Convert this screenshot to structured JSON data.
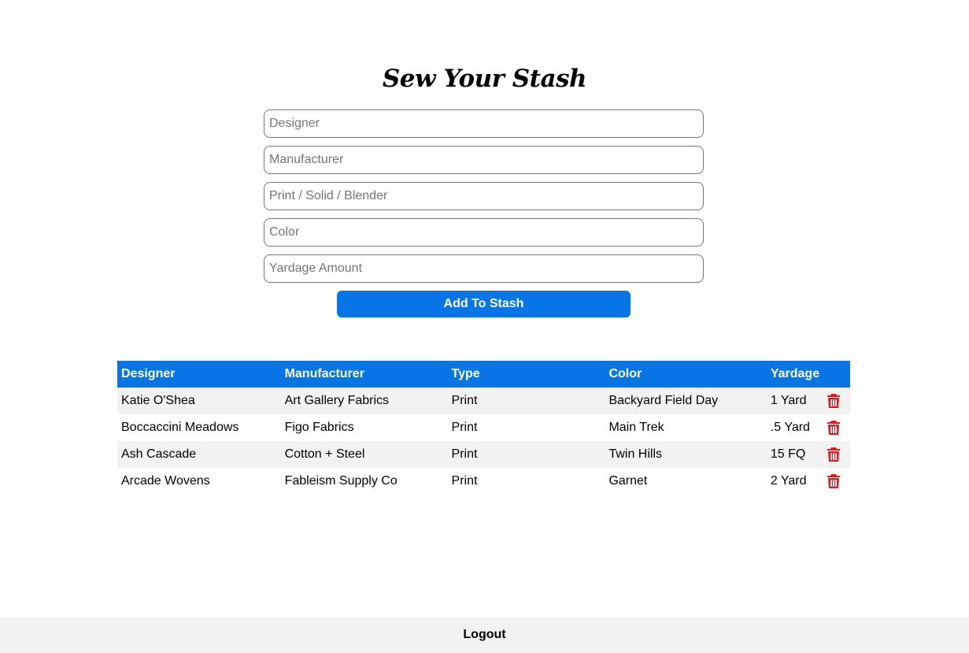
{
  "header": {
    "title": "Sew Your Stash"
  },
  "form": {
    "designer_placeholder": "Designer",
    "manufacturer_placeholder": "Manufacturer",
    "type_placeholder": "Print / Solid / Blender",
    "color_placeholder": "Color",
    "yardage_placeholder": "Yardage Amount",
    "submit_label": "Add To Stash"
  },
  "table": {
    "headers": {
      "designer": "Designer",
      "manufacturer": "Manufacturer",
      "type": "Type",
      "color": "Color",
      "yardage": "Yardage"
    },
    "rows": [
      {
        "designer": "Katie O'Shea",
        "manufacturer": "Art Gallery Fabrics",
        "type": "Print",
        "color": "Backyard Field Day",
        "yardage": "1 Yard"
      },
      {
        "designer": "Boccaccini Meadows",
        "manufacturer": "Figo Fabrics",
        "type": "Print",
        "color": "Main Trek",
        "yardage": ".5 Yard"
      },
      {
        "designer": "Ash Cascade",
        "manufacturer": "Cotton + Steel",
        "type": "Print",
        "color": "Twin Hills",
        "yardage": "15 FQ"
      },
      {
        "designer": "Arcade Wovens",
        "manufacturer": "Fableism Supply Co",
        "type": "Print",
        "color": "Garnet",
        "yardage": "2 Yard"
      }
    ],
    "delete_icon": "trash-icon"
  },
  "footer": {
    "logout_label": "Logout"
  },
  "colors": {
    "accent": "#0875e6",
    "row_stripe": "#f2f2f2",
    "delete": "#e8141a",
    "footer_bg": "#f2f2f2"
  }
}
